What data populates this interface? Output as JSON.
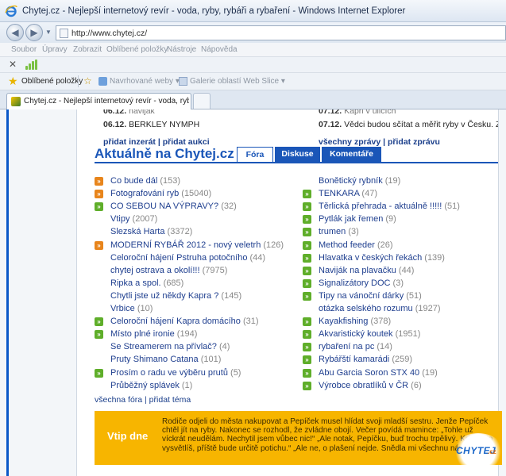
{
  "window": {
    "title": "Chytej.cz - Nejlepší internetový revír - voda, ryby, rybáři a rybaření - Windows Internet Explorer",
    "url": "http://www.chytej.cz/"
  },
  "menu": [
    "Soubor",
    "Úpravy",
    "Zobrazit",
    "Oblíbené položky",
    "Nástroje",
    "Nápověda"
  ],
  "favorites_bar": {
    "favorites": "Oblíbené položky",
    "suggested": "Navrhované weby ▾",
    "gallery": "Galerie oblastí Web Slice ▾"
  },
  "tab": {
    "title": "Chytej.cz - Nejlepší internetový revír - voda, ryby, ry..."
  },
  "news_left": [
    {
      "date": "06.12.",
      "title": "naviják",
      "cut": true
    },
    {
      "date": "06.12.",
      "title": "BERKLEY NYMPH"
    }
  ],
  "news_right": [
    {
      "date": "07.12.",
      "title": "Kapři v ulicích",
      "cut": true
    },
    {
      "date": "07.12.",
      "title": "Vědci budou sčítat a měřit ryby v Česku. Za peníz"
    }
  ],
  "ad_links": {
    "left": "přidat inzerát | přidat aukci",
    "right": "všechny zprávy | přidat zprávu"
  },
  "section": {
    "heading": "Aktuálně na Chytej.cz",
    "tabs": [
      "Fóra",
      "Diskuse",
      "Komentáře"
    ]
  },
  "forum_left": [
    {
      "icon": "orange",
      "title": "Co bude dál",
      "count": "(153)"
    },
    {
      "icon": "orange",
      "title": "Fotografování ryb",
      "count": "(15040)"
    },
    {
      "icon": "green",
      "title": "CO SEBOU NA VÝPRAVY?",
      "count": "(32)"
    },
    {
      "icon": "",
      "title": "Vtipy",
      "count": "(2007)"
    },
    {
      "icon": "",
      "title": "Slezská Harta",
      "count": "(3372)"
    },
    {
      "icon": "orange",
      "title": "MODERNÍ RYBÁŘ 2012 - nový veletrh",
      "count": "(126)"
    },
    {
      "icon": "",
      "title": "Celoroční hájení Pstruha potočního",
      "count": "(44)"
    },
    {
      "icon": "",
      "title": "chytej ostrava a okolí!!!",
      "count": "(7975)"
    },
    {
      "icon": "",
      "title": "Ripka a spol.",
      "count": "(685)"
    },
    {
      "icon": "",
      "title": "Chytli jste už někdy Kapra ?",
      "count": "(145)"
    },
    {
      "icon": "",
      "title": "Vrbice",
      "count": "(10)"
    },
    {
      "icon": "green",
      "title": "Celoroční hájení Kapra domácího",
      "count": "(31)"
    },
    {
      "icon": "green",
      "title": "Místo plné ironie",
      "count": "(194)"
    },
    {
      "icon": "",
      "title": "Se Streamerem na přívlač?",
      "count": "(4)"
    },
    {
      "icon": "",
      "title": "Pruty Shimano Catana",
      "count": "(101)"
    },
    {
      "icon": "green",
      "title": "Prosím o radu ve výběru prutů",
      "count": "(5)"
    },
    {
      "icon": "",
      "title": "Průběžný splávek",
      "count": "(1)"
    }
  ],
  "forum_right": [
    {
      "icon": "",
      "title": "Bonětický rybník",
      "count": "(19)"
    },
    {
      "icon": "green",
      "title": "TENKARA",
      "count": "(47)"
    },
    {
      "icon": "green",
      "title": "Těrlická přehrada - aktuálně !!!!!",
      "count": "(51)"
    },
    {
      "icon": "green",
      "title": "Pytlák jak řemen",
      "count": "(9)"
    },
    {
      "icon": "green",
      "title": "trumen",
      "count": "(3)"
    },
    {
      "icon": "green",
      "title": "Method feeder",
      "count": "(26)"
    },
    {
      "icon": "green",
      "title": "Hlavatka v českých řekách",
      "count": "(139)"
    },
    {
      "icon": "green",
      "title": "Naviják na plavačku",
      "count": "(44)"
    },
    {
      "icon": "green",
      "title": "Signalizátory DOC",
      "count": "(3)"
    },
    {
      "icon": "green",
      "title": "Tipy na vánoční dárky",
      "count": "(51)"
    },
    {
      "icon": "",
      "title": "otázka selského rozumu",
      "count": "(1927)"
    },
    {
      "icon": "green",
      "title": "Kayakfishing",
      "count": "(378)"
    },
    {
      "icon": "green",
      "title": "Akvaristický koutek",
      "count": "(1951)"
    },
    {
      "icon": "green",
      "title": "rybaření na pc",
      "count": "(14)"
    },
    {
      "icon": "green",
      "title": "Rybářští kamarádi",
      "count": "(259)"
    },
    {
      "icon": "green",
      "title": "Abu Garcia Soron STX 40",
      "count": "(19)"
    },
    {
      "icon": "green",
      "title": "Výrobce obratlíků v ČR",
      "count": "(6)"
    }
  ],
  "forum_footer": "všechna fóra | přidat téma",
  "joke": {
    "label": "Vtip dne",
    "text": "Rodiče odjeli do města nakupovat a Pepíček musel hlídat svoji mladší sestru. Jenže Pepíček chtěl jít na ryby. Nakonec se rozhodl, že zvládne obojí. Večer povídá mamince: „Tohle už víckrát neudělám. Nechytil jsem vůbec nic!“ „Ale notak, Pepíčku, buď trochu trpělivý. Když jí to vysvětlíš, příště bude určitě potichu.“ „Ale ne, o plašení nejde. Snědla mi všechnu návnadu.“"
  },
  "logo": {
    "main": "CHYTEJ",
    "sub": ".cz"
  },
  "colors": {
    "brand_blue": "#1a56b8",
    "joke_bg": "#f7b500",
    "icon_orange": "#e8851c",
    "icon_green": "#5fae2a"
  }
}
